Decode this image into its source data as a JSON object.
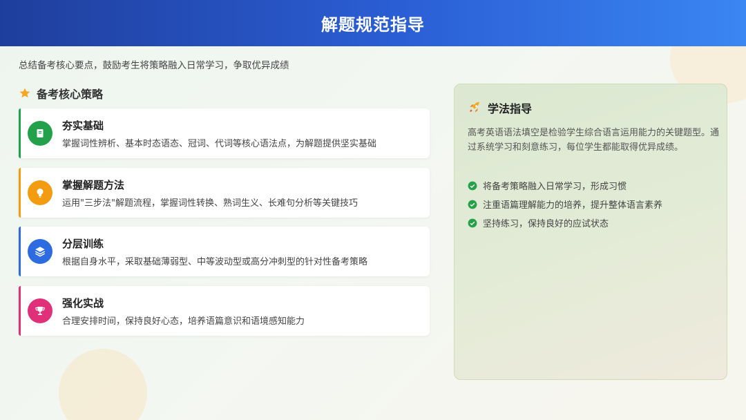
{
  "header": {
    "title": "解题规范指导"
  },
  "subtitle": "总结备考核心要点，鼓励考生将策略融入日常学习，争取优异成绩",
  "section": {
    "title": "备考核心策略"
  },
  "cards": [
    {
      "title": "夯实基础",
      "desc": "掌握词性辨析、基本时态语态、冠词、代词等核心语法点，为解题提供坚实基础",
      "color": "#22a04a",
      "icon": "book-icon"
    },
    {
      "title": "掌握解题方法",
      "desc": "运用\"三步法\"解题流程，掌握词性转换、熟词生义、长难句分析等关键技巧",
      "color": "#f39c12",
      "icon": "lightbulb-icon"
    },
    {
      "title": "分层训练",
      "desc": "根据自身水平，采取基础薄弱型、中等波动型或高分冲刺型的针对性备考策略",
      "color": "#2d6be0",
      "icon": "layers-icon"
    },
    {
      "title": "强化实战",
      "desc": "合理安排时间，保持良好心态，培养语篇意识和语境感知能力",
      "color": "#e0307a",
      "icon": "trophy-icon"
    }
  ],
  "panel": {
    "title": "学法指导",
    "desc": "高考英语语法填空是检验学生综合语言运用能力的关键题型。通过系统学习和刻意练习，每位学生都能取得优异成绩。",
    "items": [
      "将备考策略融入日常学习，形成习惯",
      "注重语篇理解能力的培养，提升整体语言素养",
      "坚持练习，保持良好的应试状态"
    ],
    "check_color": "#27a04a",
    "icon": "rocket-icon"
  }
}
